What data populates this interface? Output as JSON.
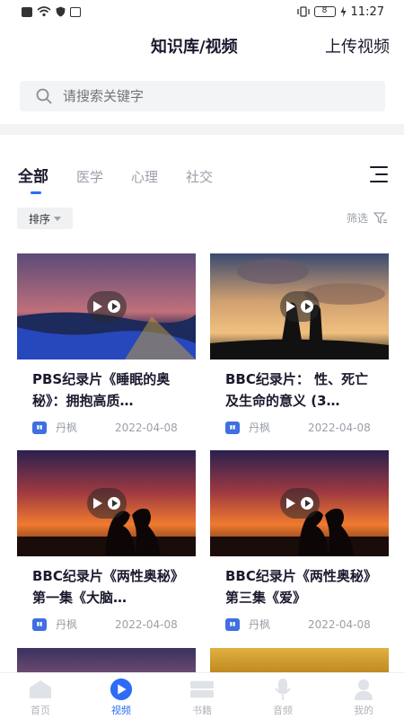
{
  "status_bar": {
    "time": "11:27",
    "battery": "8"
  },
  "header": {
    "title": "知识库/视频",
    "upload_label": "上传视频"
  },
  "search": {
    "placeholder": "请搜索关键字"
  },
  "tabs": [
    {
      "label": "全部",
      "active": true
    },
    {
      "label": "医学",
      "active": false
    },
    {
      "label": "心理",
      "active": false
    },
    {
      "label": "社交",
      "active": false
    }
  ],
  "sort": {
    "label": "排序"
  },
  "filter": {
    "label": "筛选"
  },
  "videos": [
    {
      "title": "PBS纪录片《睡眠的奥秘》：拥抱高质…",
      "author": "丹枫",
      "date": "2022-04-08",
      "thumb_icon": "night-sky-thumbnail"
    },
    {
      "title": "BBC纪录片： 性、死亡及生命的意义 (3…",
      "author": "丹枫",
      "date": "2022-04-08",
      "thumb_icon": "couple-silhouette-thumbnail"
    },
    {
      "title": "BBC纪录片《两性奥秘》第一集《大脑…",
      "author": "丹枫",
      "date": "2022-04-08",
      "thumb_icon": "sunset-kiss-thumbnail"
    },
    {
      "title": "BBC纪录片《两性奥秘》第三集《爱》",
      "author": "丹枫",
      "date": "2022-04-08",
      "thumb_icon": "sunset-kiss-thumbnail"
    }
  ],
  "bottom_nav": [
    {
      "label": "首页",
      "icon": "home-icon",
      "active": false
    },
    {
      "label": "视频",
      "icon": "video-play-icon",
      "active": true
    },
    {
      "label": "书籍",
      "icon": "book-icon",
      "active": false
    },
    {
      "label": "音频",
      "icon": "microphone-icon",
      "active": false
    },
    {
      "label": "我的",
      "icon": "user-icon",
      "active": false
    }
  ],
  "colors": {
    "accent": "#2d6cf6",
    "text": "#1a1a2e",
    "muted": "#9aa0a8",
    "author_badge": "#3f6fe0"
  }
}
